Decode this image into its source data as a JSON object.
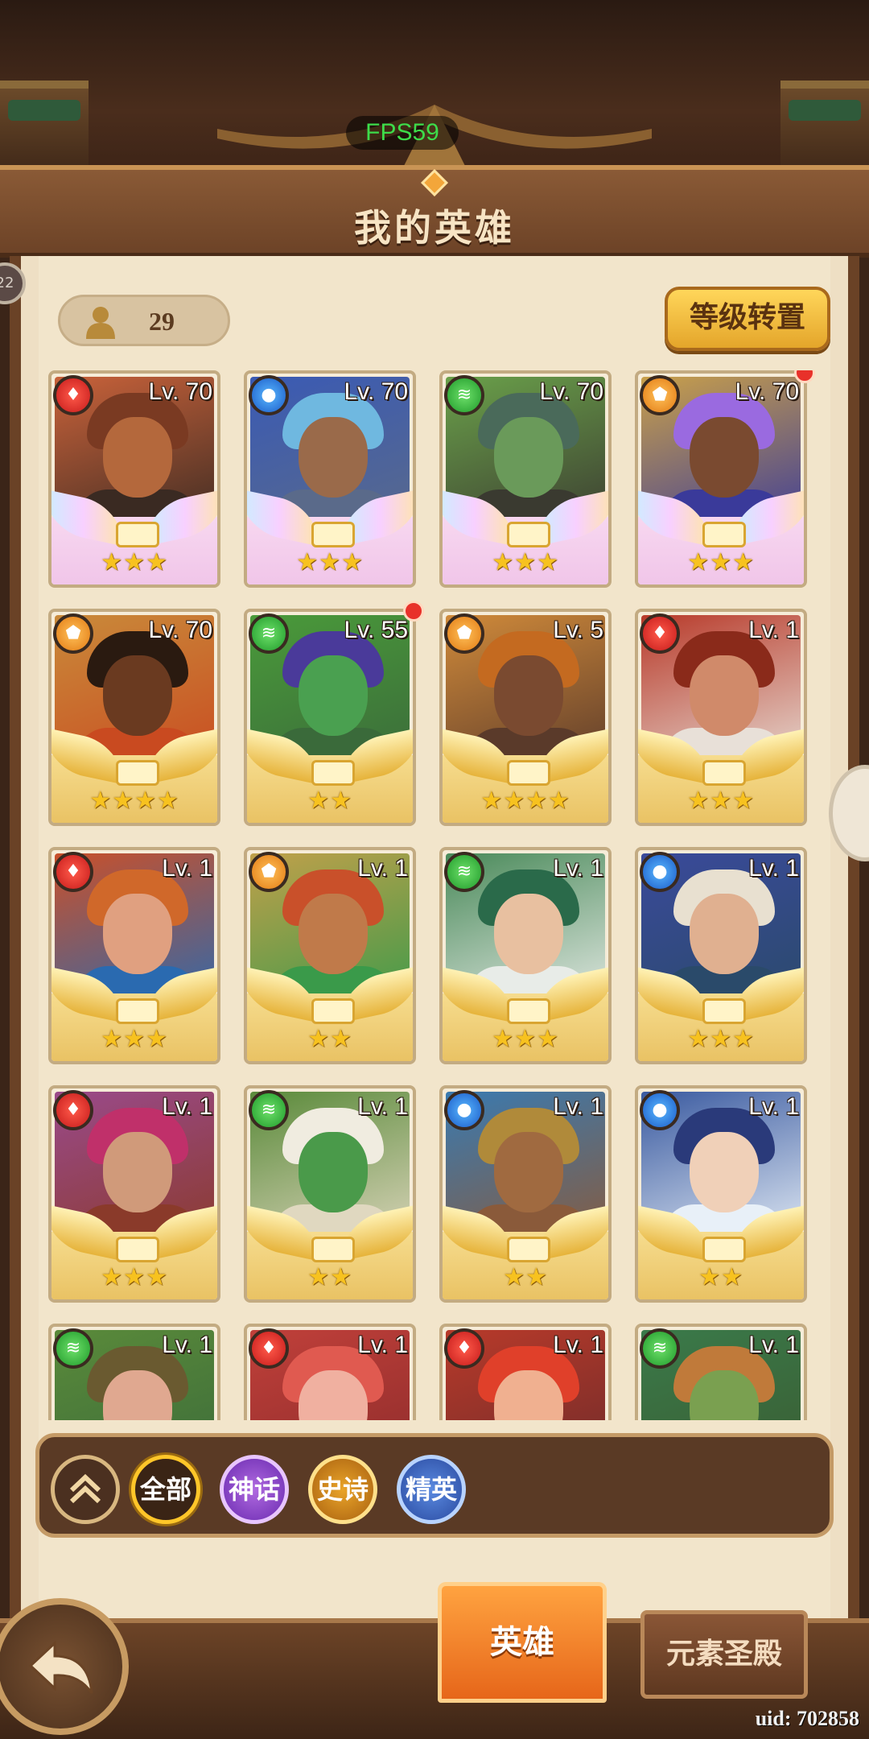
{
  "header": {
    "fps": "FPS59",
    "title": "我的英雄"
  },
  "side_badge": "22",
  "hero_count": "29",
  "level_transfer_button": "等级转置",
  "heroes": [
    {
      "element": "fire",
      "level": "Lv. 70",
      "stars": "★★★",
      "rarity": "mythic",
      "red_dot": false,
      "colors": [
        "#c9623a",
        "#7a3a22",
        "#b4683c",
        "#3a2a22"
      ]
    },
    {
      "element": "water",
      "level": "Lv. 70",
      "stars": "★★★",
      "rarity": "mythic",
      "red_dot": false,
      "colors": [
        "#3a5ab4",
        "#6fb8e0",
        "#9a6a4a",
        "#5a6a8a"
      ]
    },
    {
      "element": "wind",
      "level": "Lv. 70",
      "stars": "★★★",
      "rarity": "mythic",
      "red_dot": false,
      "colors": [
        "#6aa04a",
        "#4a6a5a",
        "#6a9a5a",
        "#3a3a30"
      ]
    },
    {
      "element": "light",
      "level": "Lv. 70",
      "stars": "★★★",
      "rarity": "mythic",
      "red_dot": true,
      "colors": [
        "#c9a04a",
        "#9a6ae0",
        "#7a4a30",
        "#3a3a9a"
      ]
    },
    {
      "element": "light",
      "level": "Lv. 70",
      "stars": "★★★★",
      "rarity": "gold",
      "red_dot": false,
      "colors": [
        "#c98a3a",
        "#2a1a10",
        "#6a3a20",
        "#c94a20"
      ]
    },
    {
      "element": "wind",
      "level": "Lv. 55",
      "stars": "★★",
      "rarity": "gold",
      "red_dot": true,
      "colors": [
        "#4a9a3a",
        "#4a3a9a",
        "#4aa050",
        "#3a6a3a"
      ]
    },
    {
      "element": "light",
      "level": "Lv. 5",
      "stars": "★★★★",
      "rarity": "gold",
      "red_dot": false,
      "colors": [
        "#d08a3a",
        "#c46a20",
        "#7a4a30",
        "#5a3a2a"
      ]
    },
    {
      "element": "fire",
      "level": "Lv. 1",
      "stars": "★★★",
      "rarity": "gold",
      "red_dot": false,
      "colors": [
        "#b83a2a",
        "#8a2a1a",
        "#d08a6a",
        "#e8e0d8"
      ]
    },
    {
      "element": "fire",
      "level": "Lv. 1",
      "stars": "★★★",
      "rarity": "gold",
      "red_dot": false,
      "colors": [
        "#c9502a",
        "#d0682a",
        "#e0a080",
        "#2a6ab0"
      ]
    },
    {
      "element": "light",
      "level": "Lv. 1",
      "stars": "★★",
      "rarity": "gold",
      "red_dot": false,
      "colors": [
        "#c0a04a",
        "#c9502a",
        "#c07a4a",
        "#3a9a4a"
      ]
    },
    {
      "element": "wind",
      "level": "Lv. 1",
      "stars": "★★★",
      "rarity": "gold",
      "red_dot": false,
      "colors": [
        "#4a8a5a",
        "#2a6a4a",
        "#e8c0a0",
        "#e8ece8"
      ]
    },
    {
      "element": "water",
      "level": "Lv. 1",
      "stars": "★★★",
      "rarity": "gold",
      "red_dot": false,
      "colors": [
        "#3a4a9a",
        "#e8e0d0",
        "#e0b090",
        "#2a4a6a"
      ]
    },
    {
      "element": "fire",
      "level": "Lv. 1",
      "stars": "★★★",
      "rarity": "gold",
      "red_dot": false,
      "colors": [
        "#9a4a8a",
        "#c0306a",
        "#d09a7a",
        "#8a3a2a"
      ]
    },
    {
      "element": "wind",
      "level": "Lv. 1",
      "stars": "★★",
      "rarity": "gold",
      "red_dot": false,
      "colors": [
        "#5a8a3a",
        "#f0ece0",
        "#4a9a4a",
        "#e0d8c0"
      ]
    },
    {
      "element": "water",
      "level": "Lv. 1",
      "stars": "★★",
      "rarity": "gold",
      "red_dot": false,
      "colors": [
        "#3a7ab0",
        "#b08a3a",
        "#a06a40",
        "#8a5a3a"
      ]
    },
    {
      "element": "water",
      "level": "Lv. 1",
      "stars": "★★",
      "rarity": "gold",
      "red_dot": false,
      "colors": [
        "#3a5aa0",
        "#2a3a7a",
        "#f0d0b8",
        "#e8f0f8"
      ]
    },
    {
      "element": "wind",
      "level": "Lv. 1",
      "stars": "",
      "rarity": "gold",
      "red_dot": false,
      "colors": [
        "#5a8a3a",
        "#6a5a30",
        "#e0a890",
        "#3a6a3a"
      ]
    },
    {
      "element": "fire",
      "level": "Lv. 1",
      "stars": "",
      "rarity": "gold",
      "red_dot": false,
      "colors": [
        "#c0403a",
        "#e05a50",
        "#f0b0a0",
        "#8a2a2a"
      ]
    },
    {
      "element": "fire",
      "level": "Lv. 1",
      "stars": "",
      "rarity": "gold",
      "red_dot": false,
      "colors": [
        "#b83a2a",
        "#e0402a",
        "#f0b090",
        "#6a2a2a"
      ]
    },
    {
      "element": "wind",
      "level": "Lv. 1",
      "stars": "",
      "rarity": "gold",
      "red_dot": false,
      "colors": [
        "#3a7a4a",
        "#c07a3a",
        "#7aa050",
        "#3a5a30"
      ]
    }
  ],
  "element_icons": {
    "fire": "fire-gem-icon",
    "water": "water-gem-icon",
    "wind": "wind-gem-icon",
    "light": "light-gem-icon"
  },
  "filters": {
    "all": "全部",
    "mythic": "神话",
    "epic": "史诗",
    "elite": "精英"
  },
  "tabs": {
    "hero": "英雄",
    "element_temple": "元素圣殿"
  },
  "uid": "uid: 702858"
}
